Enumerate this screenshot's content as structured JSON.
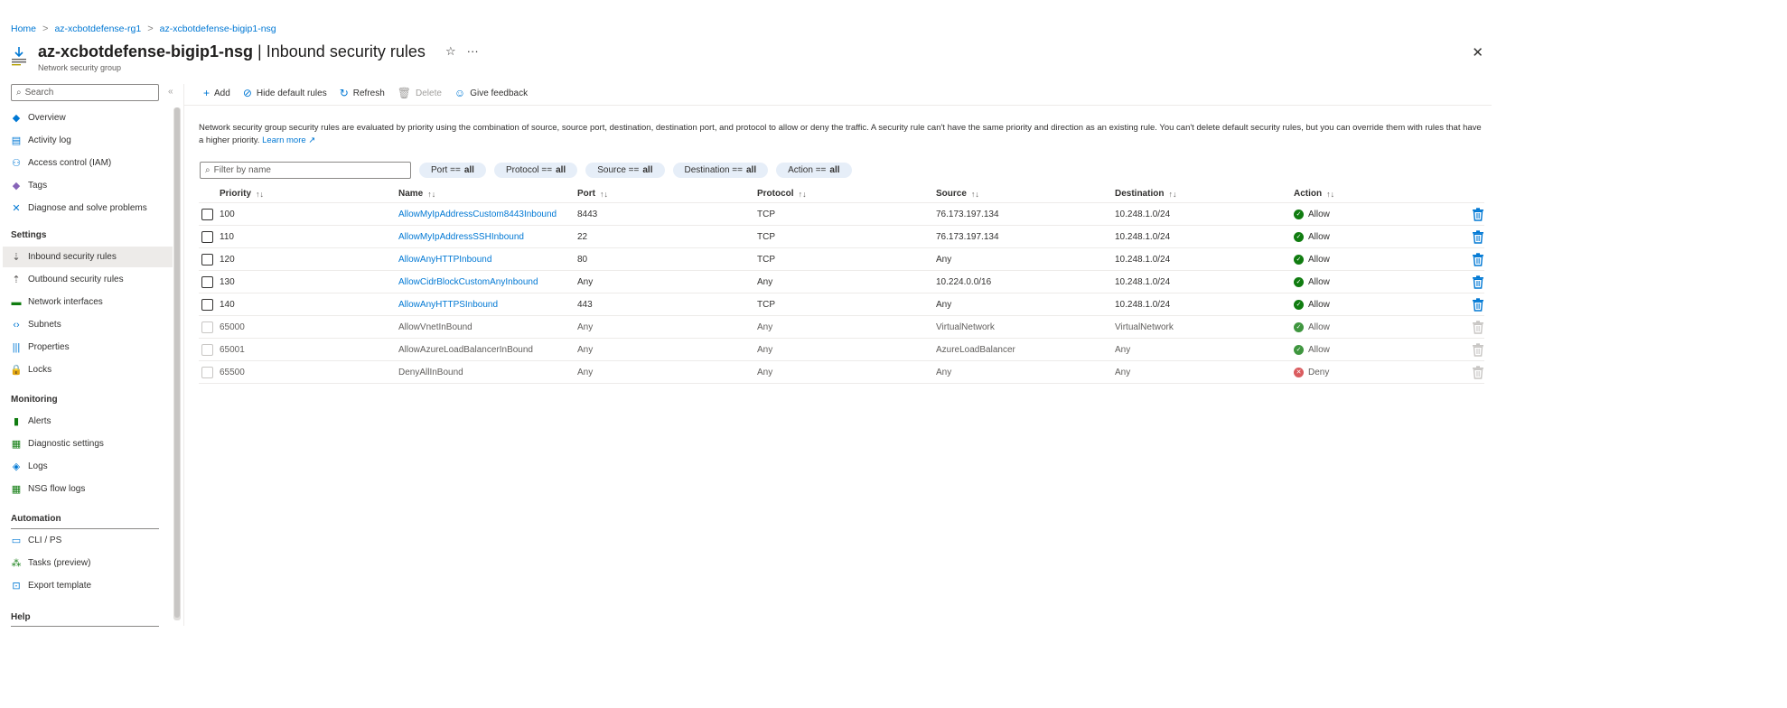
{
  "breadcrumb": {
    "items": [
      "Home",
      "az-xcbotdefense-rg1",
      "az-xcbotdefense-bigip1-nsg"
    ],
    "separator": ">"
  },
  "header": {
    "resource_name": "az-xcbotdefense-bigip1-nsg",
    "title_separator": "|",
    "page_name": "Inbound security rules",
    "subtitle": "Network security group",
    "favorite_icon": "star-icon",
    "more_icon": "ellipsis-icon",
    "favorite_glyph": "☆",
    "more_glyph": "···",
    "close_glyph": "✕"
  },
  "sidebar": {
    "search_placeholder": "Search",
    "collapse_glyph": "«",
    "items_top": [
      {
        "label": "Overview",
        "icon": "shield-icon",
        "glyph": "◆",
        "color": "#0078d4"
      },
      {
        "label": "Activity log",
        "icon": "activity-log-icon",
        "glyph": "▤",
        "color": "#0078d4"
      },
      {
        "label": "Access control (IAM)",
        "icon": "people-icon",
        "glyph": "⚇",
        "color": "#0078d4"
      },
      {
        "label": "Tags",
        "icon": "tag-icon",
        "glyph": "◆",
        "color": "#8764b8"
      },
      {
        "label": "Diagnose and solve problems",
        "icon": "wrench-icon",
        "glyph": "✕",
        "color": "#0078d4"
      }
    ],
    "settings_label": "Settings",
    "items_settings": [
      {
        "label": "Inbound security rules",
        "icon": "inbound-rules-icon",
        "glyph": "⇣",
        "color": "#605e5c",
        "active": true
      },
      {
        "label": "Outbound security rules",
        "icon": "outbound-rules-icon",
        "glyph": "⇡",
        "color": "#605e5c"
      },
      {
        "label": "Network interfaces",
        "icon": "network-interface-icon",
        "glyph": "▬",
        "color": "#107c10"
      },
      {
        "label": "Subnets",
        "icon": "subnet-icon",
        "glyph": "‹›",
        "color": "#0078d4"
      },
      {
        "label": "Properties",
        "icon": "properties-icon",
        "glyph": "|||",
        "color": "#0078d4"
      },
      {
        "label": "Locks",
        "icon": "lock-icon",
        "glyph": "🔒",
        "color": "#0078d4"
      }
    ],
    "monitoring_label": "Monitoring",
    "items_monitoring": [
      {
        "label": "Alerts",
        "icon": "alerts-icon",
        "glyph": "▮",
        "color": "#107c10"
      },
      {
        "label": "Diagnostic settings",
        "icon": "diagnostic-settings-icon",
        "glyph": "▦",
        "color": "#107c10"
      },
      {
        "label": "Logs",
        "icon": "logs-icon",
        "glyph": "◈",
        "color": "#0078d4"
      },
      {
        "label": "NSG flow logs",
        "icon": "flow-logs-icon",
        "glyph": "▦",
        "color": "#107c10"
      }
    ],
    "automation_label": "Automation",
    "items_automation": [
      {
        "label": "CLI / PS",
        "icon": "cli-icon",
        "glyph": "▭",
        "color": "#0078d4"
      },
      {
        "label": "Tasks (preview)",
        "icon": "tasks-icon",
        "glyph": "⁂",
        "color": "#107c10"
      },
      {
        "label": "Export template",
        "icon": "export-template-icon",
        "glyph": "⊡",
        "color": "#0078d4"
      }
    ],
    "help_label": "Help"
  },
  "toolbar": {
    "add": {
      "label": "Add",
      "glyph": "+"
    },
    "hide_default": {
      "label": "Hide default rules",
      "glyph": "⊘"
    },
    "refresh": {
      "label": "Refresh",
      "glyph": "↻"
    },
    "delete": {
      "label": "Delete",
      "glyph": "🗑"
    },
    "feedback": {
      "label": "Give feedback",
      "glyph": "☺"
    }
  },
  "description": {
    "text": "Network security group security rules are evaluated by priority using the combination of source, source port, destination, destination port, and protocol to allow or deny the traffic. A security rule can't have the same priority and direction as an existing rule. You can't delete default security rules, but you can override them with rules that have a higher priority.",
    "learn_more": "Learn more ↗"
  },
  "filters": {
    "placeholder": "Filter by name",
    "pills": [
      {
        "key": "Port ==",
        "value": "all"
      },
      {
        "key": "Protocol ==",
        "value": "all"
      },
      {
        "key": "Source ==",
        "value": "all"
      },
      {
        "key": "Destination ==",
        "value": "all"
      },
      {
        "key": "Action ==",
        "value": "all"
      }
    ]
  },
  "table": {
    "columns": [
      "Priority",
      "Name",
      "Port",
      "Protocol",
      "Source",
      "Destination",
      "Action"
    ],
    "priority_sort": "↑↓",
    "sort": "↑↓",
    "rows": [
      {
        "priority": "100",
        "name": "AllowMyIpAddressCustom8443Inbound",
        "port": "8443",
        "protocol": "TCP",
        "source": "76.173.197.134",
        "destination": "10.248.1.0/24",
        "action": "Allow",
        "default": false
      },
      {
        "priority": "110",
        "name": "AllowMyIpAddressSSHInbound",
        "port": "22",
        "protocol": "TCP",
        "source": "76.173.197.134",
        "destination": "10.248.1.0/24",
        "action": "Allow",
        "default": false
      },
      {
        "priority": "120",
        "name": "AllowAnyHTTPInbound",
        "port": "80",
        "protocol": "TCP",
        "source": "Any",
        "destination": "10.248.1.0/24",
        "action": "Allow",
        "default": false
      },
      {
        "priority": "130",
        "name": "AllowCidrBlockCustomAnyInbound",
        "port": "Any",
        "protocol": "Any",
        "source": "10.224.0.0/16",
        "destination": "10.248.1.0/24",
        "action": "Allow",
        "default": false
      },
      {
        "priority": "140",
        "name": "AllowAnyHTTPSInbound",
        "port": "443",
        "protocol": "TCP",
        "source": "Any",
        "destination": "10.248.1.0/24",
        "action": "Allow",
        "default": false
      },
      {
        "priority": "65000",
        "name": "AllowVnetInBound",
        "port": "Any",
        "protocol": "Any",
        "source": "VirtualNetwork",
        "destination": "VirtualNetwork",
        "action": "Allow",
        "default": true
      },
      {
        "priority": "65001",
        "name": "AllowAzureLoadBalancerInBound",
        "port": "Any",
        "protocol": "Any",
        "source": "AzureLoadBalancer",
        "destination": "Any",
        "action": "Allow",
        "default": true
      },
      {
        "priority": "65500",
        "name": "DenyAllInBound",
        "port": "Any",
        "protocol": "Any",
        "source": "Any",
        "destination": "Any",
        "action": "Deny",
        "default": true
      }
    ]
  },
  "colors": {
    "accent": "#0078d4",
    "allow": "#107c10",
    "deny": "#d13438",
    "delete_icon": "#0078d4",
    "delete_icon_disabled": "#c8c6c4"
  }
}
